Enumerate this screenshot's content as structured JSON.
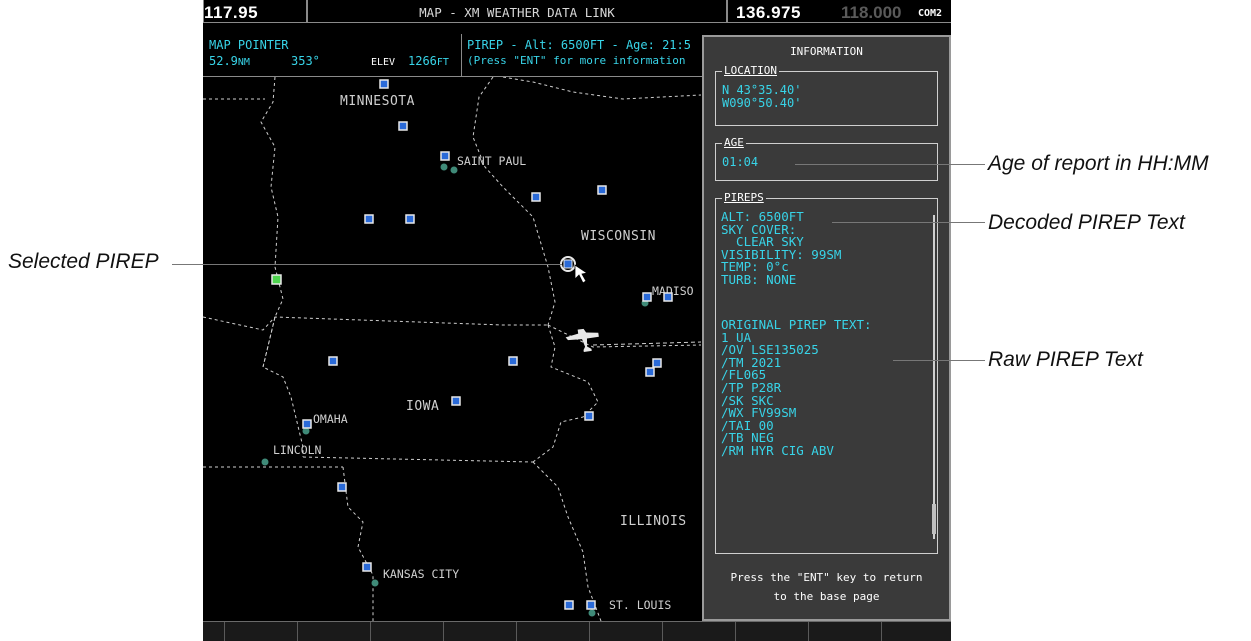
{
  "top_bar": {
    "nav_freq": "117.95",
    "page_title": "MAP - XM WEATHER DATA LINK",
    "com_active": "136.975",
    "com_standby": "118.000",
    "com_label": "COM2"
  },
  "map_pointer": {
    "label": "MAP POINTER",
    "distance": "52.9",
    "distance_unit": "NM",
    "bearing": "353°",
    "elev_label": "ELEV",
    "elev_value": "1266",
    "elev_unit": "FT"
  },
  "pirep_strip": {
    "line1": "PIREP - Alt: 6500FT - Age: 21:5",
    "line2": "(Press \"ENT\" for more information"
  },
  "map": {
    "state_labels": [
      "MINNESOTA",
      "WISCONSIN",
      "IOWA",
      "ILLINOIS"
    ],
    "city_labels": [
      "SAINT PAUL",
      "MADISO",
      "OMAHA",
      "LINCOLN",
      "KANSAS CITY",
      "ST. LOUIS"
    ]
  },
  "info_window": {
    "title": "INFORMATION",
    "location_label": "LOCATION",
    "location_lat": "N 43°35.40'",
    "location_lon": "W090°50.40'",
    "age_label": "AGE",
    "age_value": "01:04",
    "pireps_label": "PIREPS",
    "decoded": [
      "ALT: 6500FT",
      "SKY COVER:",
      "  CLEAR SKY",
      "VISIBILITY: 99SM",
      "TEMP: 0°c",
      "TURB: NONE"
    ],
    "original_header": "ORIGINAL PIREP TEXT:",
    "original": [
      "1 UA",
      "/OV LSE135025",
      "/TM 2021",
      "/FL065",
      "/TP P28R",
      "/SK SKC",
      "/WX FV99SM",
      "/TAI 00",
      "/TB NEG",
      "/RM HYR CIG ABV"
    ],
    "footer_line1": "Press the \"ENT\" key to return",
    "footer_line2": "to the base page"
  },
  "callouts": {
    "age": "Age of report in HH:MM",
    "decoded": "Decoded PIREP Text",
    "raw": "Raw PIREP Text",
    "selected": "Selected PIREP"
  },
  "colors": {
    "cyan_text": "#38d4e8",
    "pirep_marker": "#2a6ad8",
    "selected_marker": "#4fd44f",
    "info_bg": "#3a3a3a"
  }
}
